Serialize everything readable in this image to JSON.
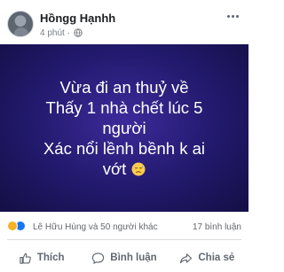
{
  "post": {
    "author": "Hồngg Hạnhh",
    "timestamp": "4 phút ·",
    "audience_icon": "globe-icon",
    "more_icon": "more-options-icon",
    "background": {
      "color_inner": "#3d2a9b",
      "color_outer": "#140f45"
    },
    "text_lines": [
      "Vừa đi an thuỷ về",
      "Thấy 1 nhà chết lúc 5",
      "người",
      "Xác nổi lềnh bềnh k ai",
      "vớt"
    ],
    "emoji": "sad-face-emoji"
  },
  "engagement": {
    "reactions_text": "Lê Hữu Hùng và 50 người khác",
    "reaction_icons": [
      "sad-reaction-icon",
      "like-reaction-icon"
    ],
    "comments_text": "17 bình luận"
  },
  "actions": {
    "like_label": "Thích",
    "comment_label": "Bình luận",
    "share_label": "Chia sẻ"
  },
  "colors": {
    "accent": "#1877f2",
    "secondary_text": "#65676b"
  }
}
